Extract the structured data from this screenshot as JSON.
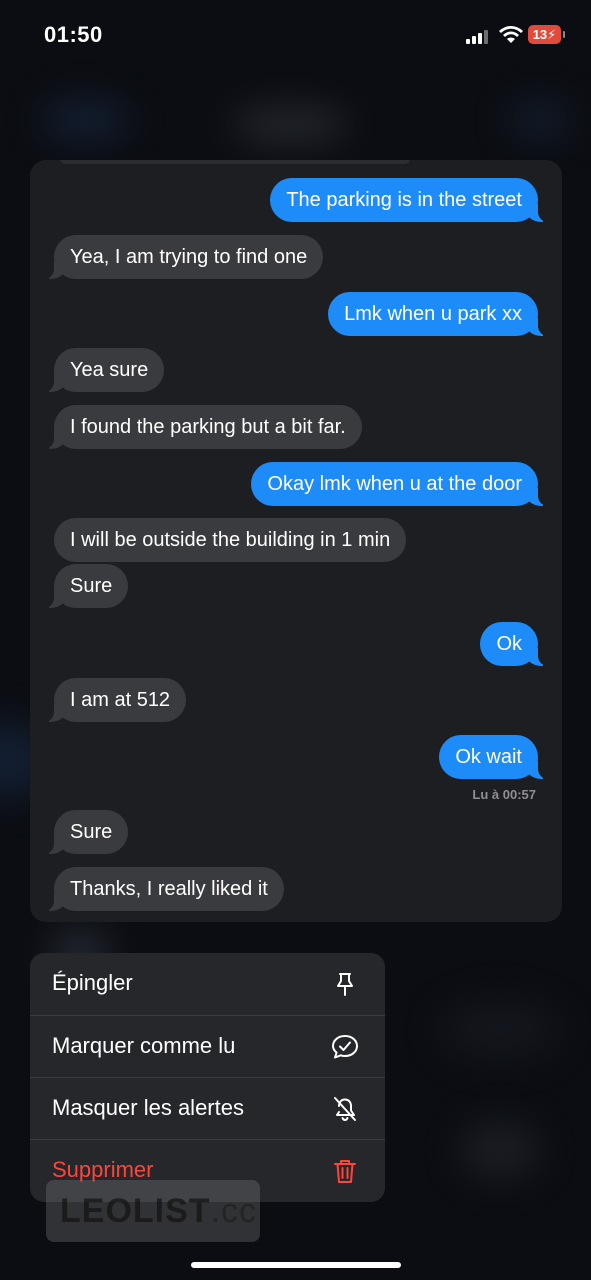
{
  "status_bar": {
    "time": "01:50",
    "battery": "13"
  },
  "conversation": {
    "messages": [
      {
        "direction": "outgoing",
        "text": "The parking is in the street"
      },
      {
        "direction": "incoming",
        "text": "Yea, I am trying to find one"
      },
      {
        "direction": "outgoing",
        "text": "Lmk when u park xx"
      },
      {
        "direction": "incoming",
        "text": "Yea sure"
      },
      {
        "direction": "incoming",
        "text": "I found the parking but a bit far."
      },
      {
        "direction": "outgoing",
        "text": "Okay lmk when u at the door"
      },
      {
        "direction": "incoming",
        "text": "I will be outside the building in 1 min"
      },
      {
        "direction": "incoming",
        "text": "Sure"
      },
      {
        "direction": "outgoing",
        "text": "Ok"
      },
      {
        "direction": "incoming",
        "text": "I am at 512"
      },
      {
        "direction": "outgoing",
        "text": "Ok wait"
      },
      {
        "direction": "incoming",
        "text": "Sure"
      },
      {
        "direction": "incoming",
        "text": "Thanks, I really liked it"
      }
    ],
    "read_receipt": "Lu à 00:57"
  },
  "context_menu": {
    "items": [
      {
        "label": "Épingler",
        "icon": "pin-icon"
      },
      {
        "label": "Marquer comme lu",
        "icon": "message-check-icon"
      },
      {
        "label": "Masquer les alertes",
        "icon": "bell-slash-icon"
      },
      {
        "label": "Supprimer",
        "icon": "trash-icon",
        "destructive": true
      }
    ]
  },
  "watermark": {
    "brand": "LEOLIST",
    "suffix": ".cc"
  },
  "colors": {
    "outgoing_bubble": "#1e8cf8",
    "incoming_bubble": "#3a3b3f",
    "destructive": "#ff453a",
    "battery_low": "#e24a3b"
  }
}
